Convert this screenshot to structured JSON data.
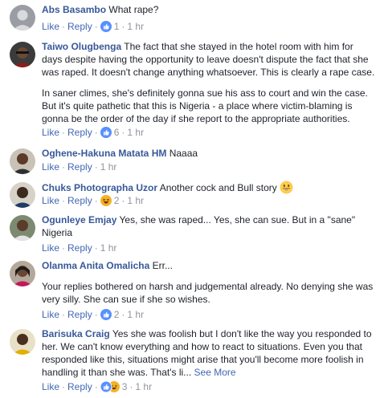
{
  "actions": {
    "like": "Like",
    "reply": "Reply",
    "separator": "·"
  },
  "comments": [
    {
      "author": "Abs Basambo",
      "text": "What rape?",
      "reactions": "1",
      "time": "1 hr"
    },
    {
      "author": "Taiwo Olugbenga",
      "text": "The fact that she stayed in the hotel room with him for days despite having the opportunity to leave doesn't dispute the fact that she was raped. It doesn't change anything whatsoever. This is clearly a rape case.",
      "text2": "In saner climes, she's definitely gonna sue his ass to court and win the case. But it's quite pathetic that this is Nigeria - a place where victim-blaming is gonna be the order of the day if she report to the appropriate authorities.",
      "reactions": "6",
      "time": "1 hr"
    },
    {
      "author": "Oghene-Hakuna Matata HM",
      "text": "Naaaa",
      "time": "1 hr"
    },
    {
      "author": "Chuks Photographa Uzor",
      "text": "Another cock and Bull story",
      "emoji": "grinning-face-emoji",
      "reactions": "2",
      "time": "1 hr"
    },
    {
      "author": "Ogunleye Emjay",
      "text": "Yes, she was raped... Yes, she can sue. But in a \"sane\" Nigeria",
      "time": "1 hr"
    },
    {
      "author": "Olanma Anita Omalicha",
      "text": "Err...",
      "text2": "Your replies bothered on harsh and judgemental already. No denying she was very silly. She can sue if she so wishes.",
      "reactions": "2",
      "time": "1 hr"
    },
    {
      "author": "Barisuka Craig",
      "text": "Yes she was foolish but I don't like the way you responded to her. We can't know everything and how to react to situations. Even you that responded like this, situations might arise that you'll become more foolish in handling it than she was. That's li...",
      "see_more": "See More",
      "reactions": "3",
      "time": "1 hr"
    }
  ],
  "colors": {
    "author": "#385898",
    "link": "#4267b2",
    "meta": "#90949c",
    "text": "#1d2129",
    "like_blue": "#5890ff",
    "haha_yellow": "#f7b125"
  }
}
